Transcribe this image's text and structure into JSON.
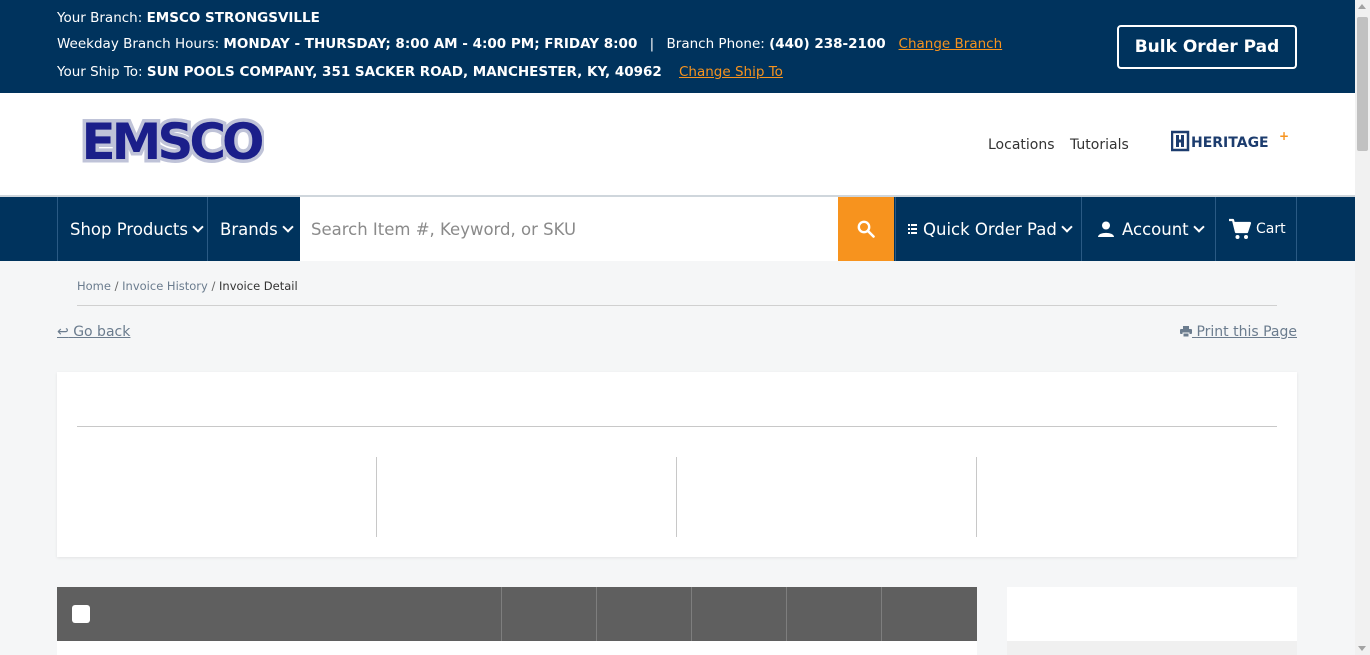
{
  "topbar": {
    "branch_label": "Your Branch:",
    "branch_name": "EMSCO STRONGSVILLE",
    "hours_label": "Weekday Branch Hours:",
    "hours_value": "MONDAY - THURSDAY; 8:00 AM - 4:00 PM; FRIDAY 8:00",
    "separator": "|",
    "phone_label": "Branch Phone:",
    "phone_value": "(440) 238-2100",
    "change_branch": "Change Branch",
    "shipto_label": "Your Ship To:",
    "shipto_value": "SUN POOLS COMPANY, 351 SACKER ROAD, MANCHESTER, KY, 40962",
    "change_shipto": "Change Ship To",
    "bulk_order": "Bulk Order Pad"
  },
  "header": {
    "logo_text": "EMSCO",
    "links": [
      "Locations",
      "Tutorials"
    ],
    "partner_logo": "HERITAGE"
  },
  "nav": {
    "shop_products": "Shop Products",
    "brands": "Brands",
    "search_placeholder": "Search Item #, Keyword, or SKU",
    "quick_order": "Quick Order Pad",
    "account": "Account",
    "cart": "Cart"
  },
  "breadcrumb": {
    "home": "Home",
    "sep": "/",
    "invoice_history": "Invoice History",
    "current": "Invoice Detail"
  },
  "actions": {
    "go_back": "Go back",
    "print": "Print this Page"
  },
  "colors": {
    "navy": "#00335d",
    "orange": "#f7931e",
    "table_header": "#5f5f5f"
  }
}
